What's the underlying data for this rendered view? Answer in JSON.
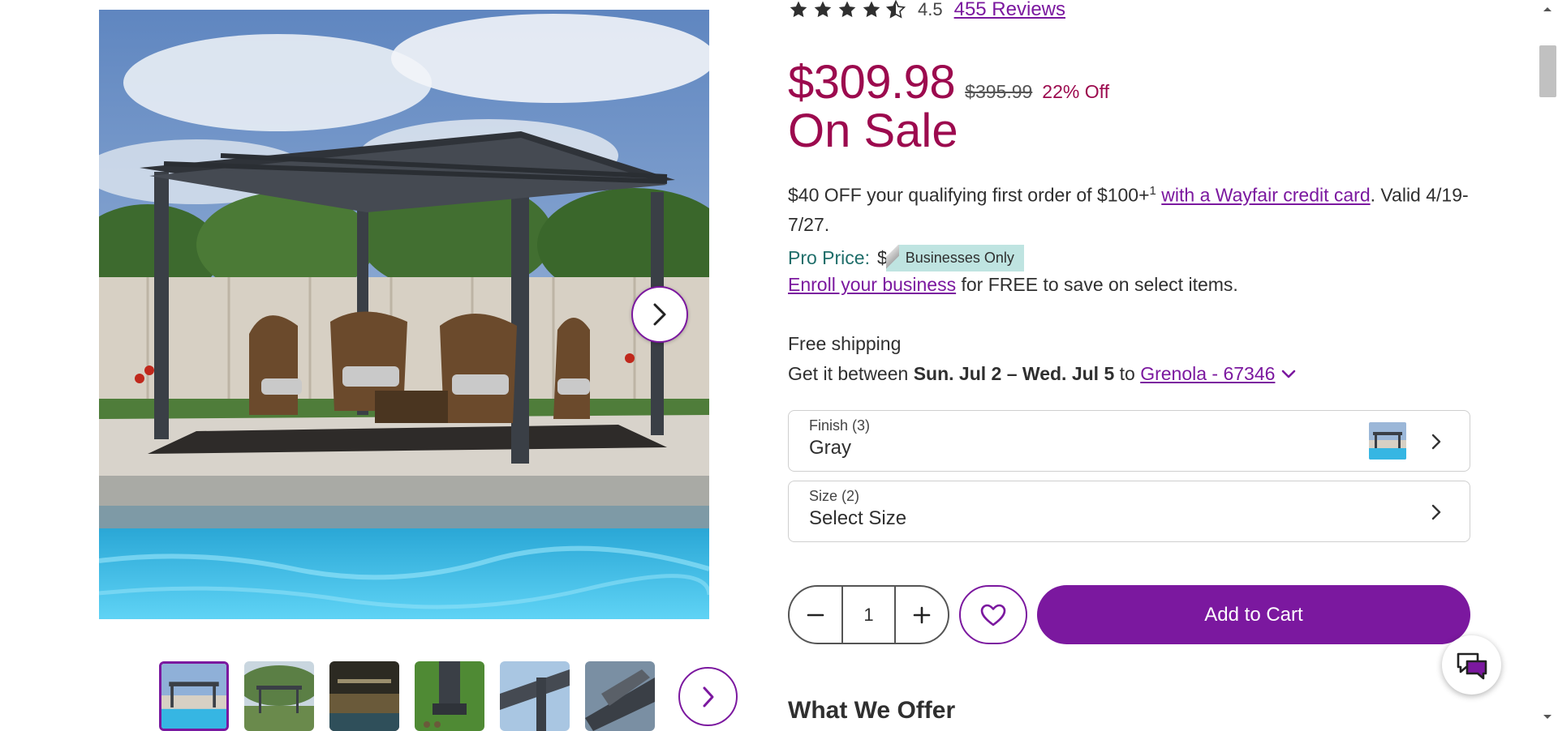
{
  "product": {
    "rating_value": "4.5",
    "rating_stars": 4.5,
    "reviews_link": "455 Reviews",
    "price": "$309.98",
    "old_price": "$395.99",
    "percent_off": "22% Off",
    "sale_label": "On Sale"
  },
  "promo": {
    "text_before": "$40 OFF your qualifying first order of $100+",
    "superscript": "1",
    "link": "with a Wayfair credit card",
    "text_after": ". Valid 4/19-7/27."
  },
  "pro_price": {
    "label": "Pro Price:",
    "dollar": "$",
    "badge": "Businesses Only",
    "enroll_link": "Enroll your business",
    "enroll_text": " for FREE to save on select items."
  },
  "shipping": {
    "free": "Free shipping",
    "get_prefix": "Get it between ",
    "dates": "Sun. Jul 2 – Wed. Jul 5",
    "to": " to ",
    "location_link": "Grenola - 67346"
  },
  "options": {
    "finish_label": "Finish (3)",
    "finish_value": "Gray",
    "size_label": "Size (2)",
    "size_value": "Select Size"
  },
  "cart": {
    "quantity": "1",
    "add_label": "Add to Cart"
  },
  "section_heading": "What We Offer",
  "gallery": {
    "thumbnail_count": 6,
    "selected_index": 0
  },
  "icons": {
    "star": "star-icon",
    "next": "chevron-right-icon",
    "minus": "minus-icon",
    "plus": "plus-icon",
    "heart": "heart-icon",
    "chat": "chat-icon"
  },
  "colors": {
    "brand_purple": "#7b189f",
    "sale_red": "#9c0a4e",
    "pro_teal": "#1f6e6a",
    "badge_bg": "#bfe4e1"
  }
}
